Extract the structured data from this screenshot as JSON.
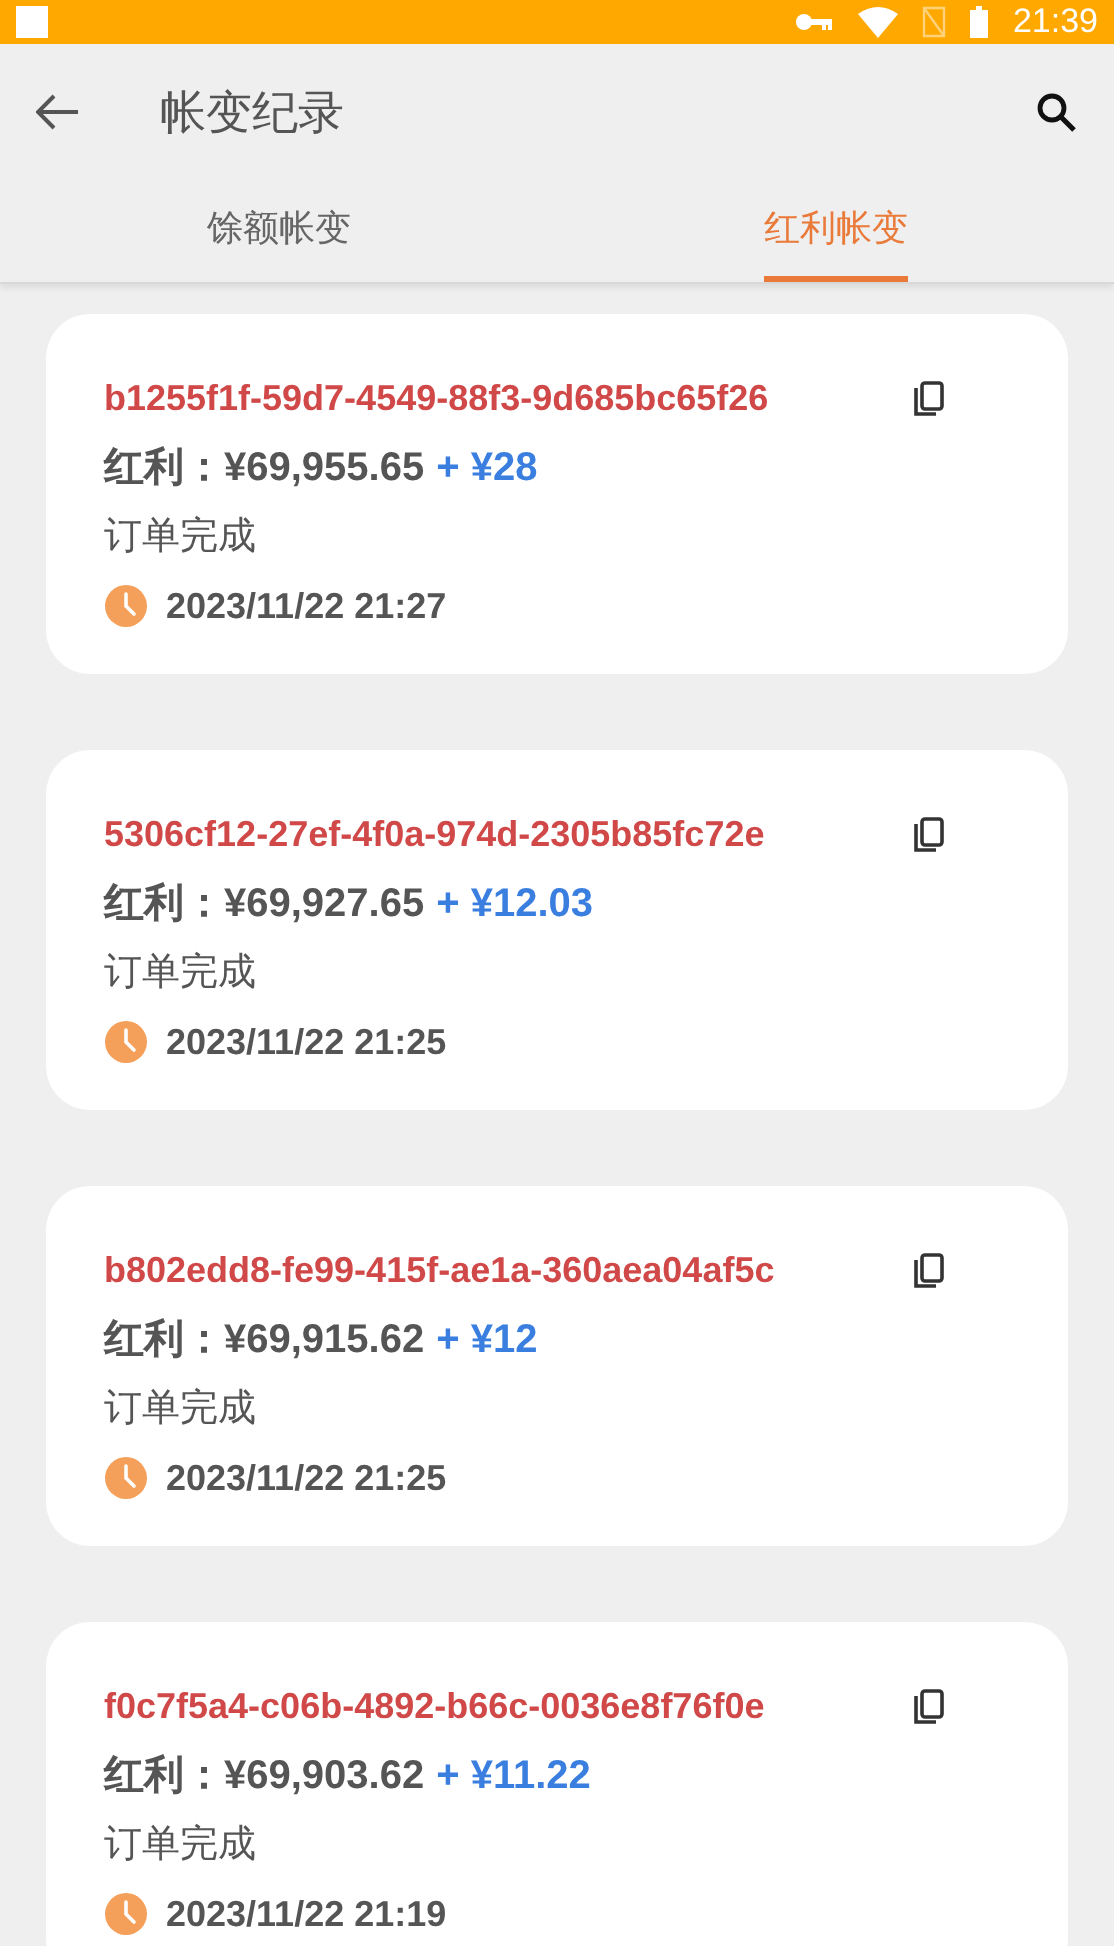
{
  "status_bar": {
    "time": "21:39"
  },
  "app_bar": {
    "title": "帐变纪录"
  },
  "tabs": [
    {
      "label": "馀额帐变",
      "selected": false
    },
    {
      "label": "红利帐变",
      "selected": true
    }
  ],
  "records": [
    {
      "id": "b1255f1f-59d7-4549-88f3-9d685bc65f26",
      "amount": "红利：¥69,955.65",
      "change": "+ ¥28",
      "status": "订单完成",
      "time": "2023/11/22 21:27"
    },
    {
      "id": "5306cf12-27ef-4f0a-974d-2305b85fc72e",
      "amount": "红利：¥69,927.65",
      "change": "+ ¥12.03",
      "status": "订单完成",
      "time": "2023/11/22 21:25"
    },
    {
      "id": "b802edd8-fe99-415f-ae1a-360aea04af5c",
      "amount": "红利：¥69,915.62",
      "change": "+ ¥12",
      "status": "订单完成",
      "time": "2023/11/22 21:25"
    },
    {
      "id": "f0c7f5a4-c06b-4892-b66c-0036e8f76f0e",
      "amount": "红利：¥69,903.62",
      "change": "+ ¥11.22",
      "status": "订单完成",
      "time": "2023/11/22 21:19"
    }
  ]
}
